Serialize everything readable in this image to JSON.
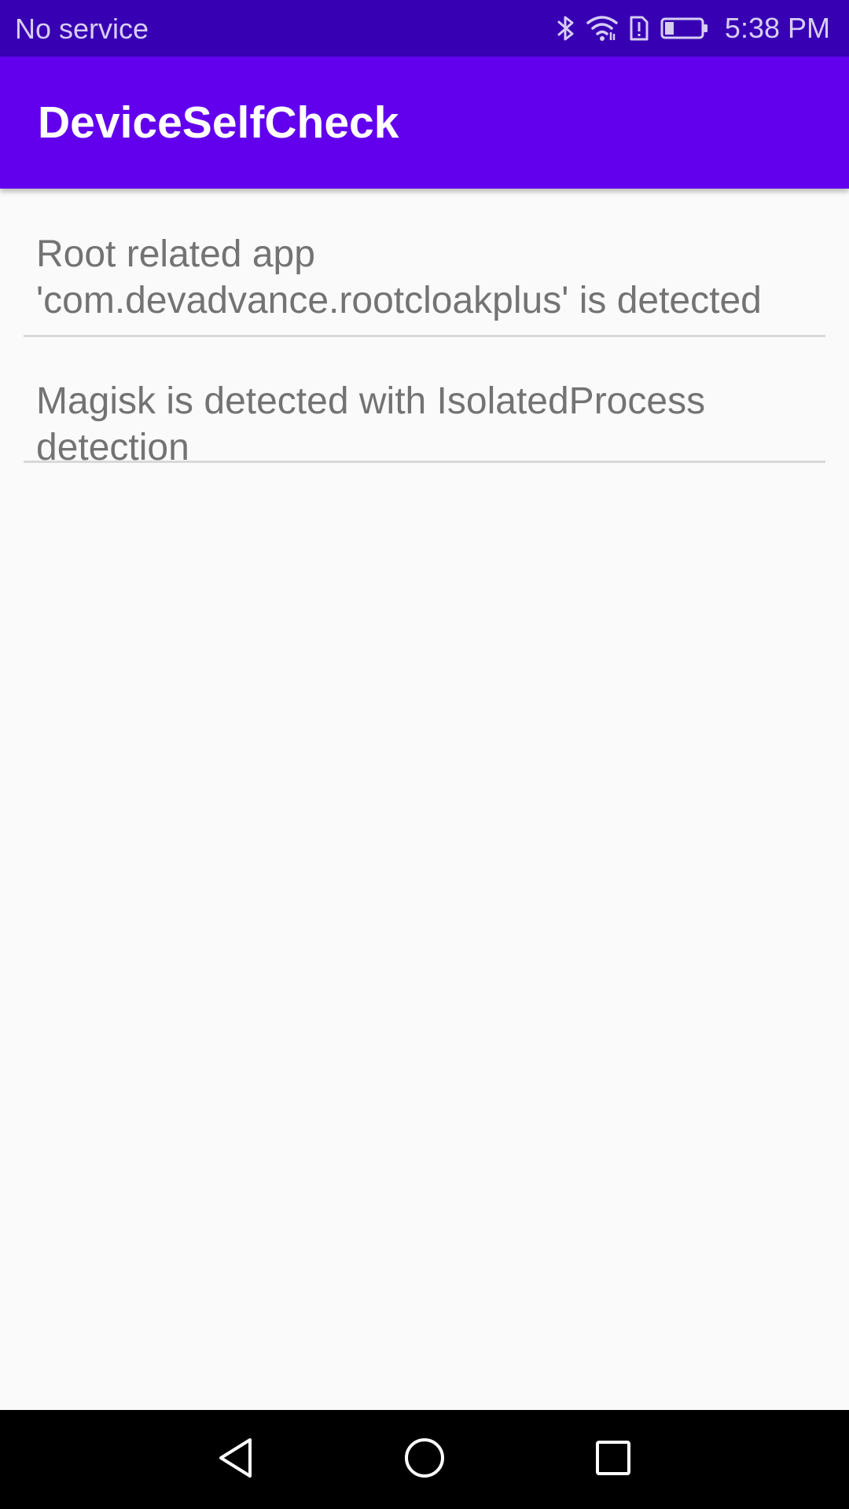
{
  "status_bar": {
    "carrier": "No service",
    "time": "5:38 PM",
    "icons": [
      "bluetooth-icon",
      "wifi-icon",
      "sim-alert-icon",
      "battery-icon"
    ],
    "battery_level": 0.25
  },
  "app_bar": {
    "title": "DeviceSelfCheck"
  },
  "results": [
    {
      "text": "Root related app 'com.devadvance.rootcloakplus' is detected"
    },
    {
      "text": "Magisk is detected with IsolatedProcess detection"
    }
  ],
  "nav_bar": {
    "buttons": [
      "back-icon",
      "home-icon",
      "recents-icon"
    ]
  },
  "colors": {
    "status_bar": "#3700b3",
    "app_bar": "#6200ee",
    "background": "#fafafa",
    "item_text": "#737373",
    "divider": "#d8d8d8"
  }
}
